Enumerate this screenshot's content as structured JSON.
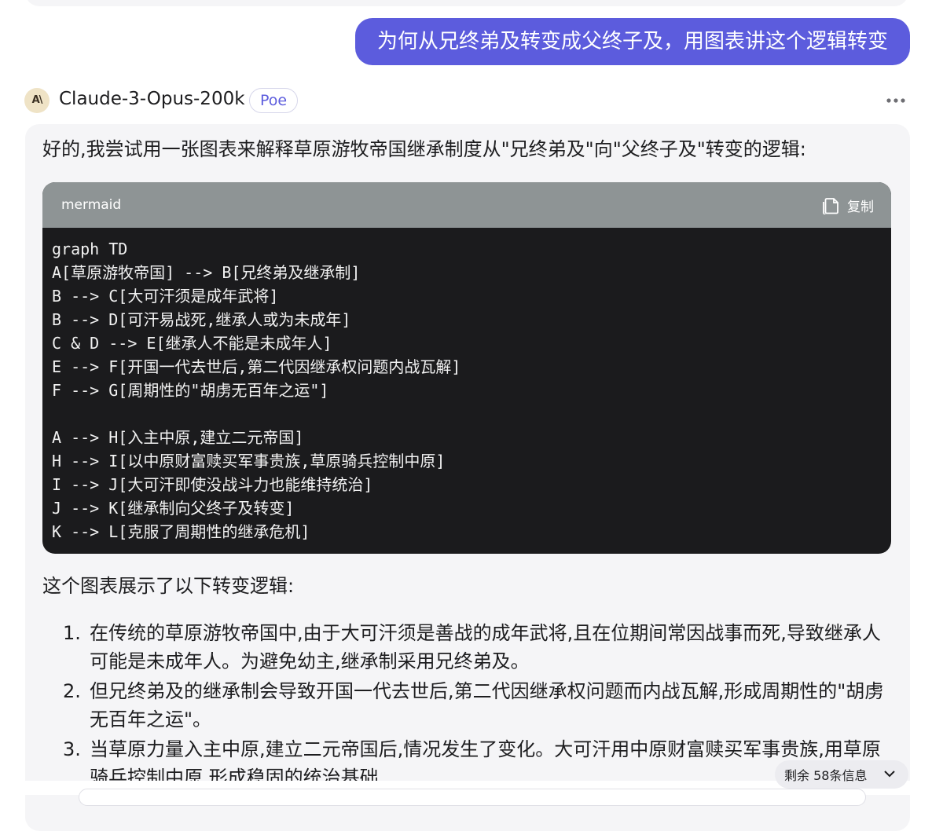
{
  "user_message": "为何从兄终弟及转变成父终子及，用图表讲这个逻辑转变",
  "bot": {
    "avatar_text": "A\\",
    "name": "Claude-3-Opus-200k",
    "badge": "Poe",
    "more_icon": "ellipsis-icon"
  },
  "response": {
    "intro": "好的,我尝试用一张图表来解释草原游牧帝国继承制度从\"兄终弟及\"向\"父终子及\"转变的逻辑:",
    "code_block": {
      "language": "mermaid",
      "copy_label": "复制",
      "lines": [
        "graph TD",
        "A[草原游牧帝国] --> B[兄终弟及继承制]",
        "B --> C[大可汗须是成年武将]",
        "B --> D[可汗易战死,继承人或为未成年]",
        "C & D --> E[继承人不能是未成年人]",
        "E --> F[开国一代去世后,第二代因继承权问题内战瓦解]",
        "F --> G[周期性的\"胡虏无百年之运\"]",
        "",
        "A --> H[入主中原,建立二元帝国]",
        "H --> I[以中原财富赎买军事贵族,草原骑兵控制中原]",
        "I --> J[大可汗即使没战斗力也能维持统治]",
        "J --> K[继承制向父终子及转变]",
        "K --> L[克服了周期性的继承危机]"
      ]
    },
    "section_heading": "这个图表展示了以下转变逻辑:",
    "steps": [
      {
        "num": "1.",
        "text": "在传统的草原游牧帝国中,由于大可汗须是善战的成年武将,且在位期间常因战事而死,导致继承人可能是未成年人。为避免幼主,继承制采用兄终弟及。"
      },
      {
        "num": "2.",
        "text": "但兄终弟及的继承制会导致开国一代去世后,第二代因继承权问题而内战瓦解,形成周期性的\"胡虏无百年之运\"。"
      },
      {
        "num": "3.",
        "text": "当草原力量入主中原,建立二元帝国后,情况发生了变化。大可汗用中原财富赎买军事贵族,用草原骑兵控制中原,形成稳固的统治基础"
      }
    ]
  },
  "remaining_label": "剩余 58条信息"
}
